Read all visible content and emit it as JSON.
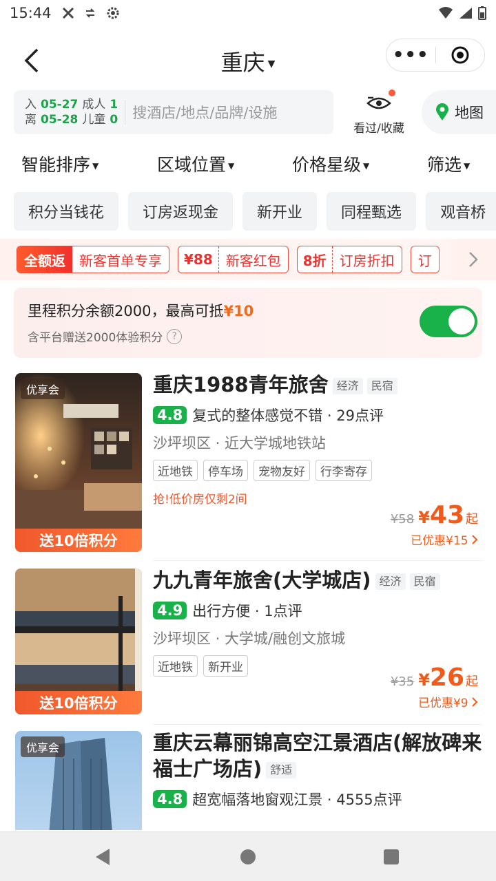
{
  "status_bar": {
    "time": "15:44"
  },
  "nav": {
    "title": "重庆",
    "more_label": "•••"
  },
  "search": {
    "checkin_label": "入",
    "checkin_date": "05-27",
    "checkout_label": "离",
    "checkout_date": "05-28",
    "adults_label": "成人",
    "adults": "1",
    "children_label": "儿童",
    "children": "0",
    "placeholder": "搜酒店/地点/品牌/设施"
  },
  "seen_fav_label": "看过/收藏",
  "map_label": "地图",
  "filters": [
    "智能排序",
    "区域位置",
    "价格星级",
    "筛选"
  ],
  "chips": [
    "积分当钱花",
    "订房返现金",
    "新开业",
    "同程甄选",
    "观音桥"
  ],
  "promo": {
    "full_rebate": "全额返",
    "new_first": "新客首单专享",
    "redpack_amount": "¥88",
    "redpack_label": "新客红包",
    "discount_amount": "8折",
    "discount_label": "订房折扣",
    "overflow_char": "订"
  },
  "points": {
    "line1_prefix": "里程积分余额2000，最高可抵",
    "line1_amount": "¥10",
    "line2": "含平台赠送2000体验积分",
    "help": "?",
    "toggle_on": true
  },
  "hotels": [
    {
      "badge_top": "优享会",
      "badge_bottom": "送10倍积分",
      "name": "重庆1988青年旅舍",
      "type_tags": [
        "经济",
        "民宿"
      ],
      "score": "4.8",
      "review": "复式的整体感觉不错 · 29点评",
      "location": "沙坪坝区 · 近大学城地铁站",
      "features": [
        "近地铁",
        "停车场",
        "宠物友好",
        "行李寄存"
      ],
      "urgent": "抢!低价房仅剩2间",
      "old_price": "¥58",
      "yen": "¥",
      "price": "43",
      "price_suffix": "起",
      "saved": "已优惠¥15"
    },
    {
      "badge_top": "",
      "badge_bottom": "送10倍积分",
      "name": "九九青年旅舍(大学城店)",
      "type_tags": [
        "经济",
        "民宿"
      ],
      "score": "4.9",
      "review": "出行方便 · 1点评",
      "location": "沙坪坝区 · 大学城/融创文旅城",
      "features": [
        "近地铁",
        "新开业"
      ],
      "urgent": "",
      "old_price": "¥35",
      "yen": "¥",
      "price": "26",
      "price_suffix": "起",
      "saved": "已优惠¥9"
    },
    {
      "badge_top": "优享会",
      "badge_bottom": "",
      "name": "重庆云幕丽锦高空江景酒店(解放碑来福士广场店)",
      "type_tags": [
        "舒适"
      ],
      "score": "4.8",
      "review": "超宽幅落地窗观江景 · 4555点评",
      "location": "",
      "features": [],
      "urgent": "",
      "old_price": "",
      "yen": "",
      "price": "",
      "price_suffix": "",
      "saved": ""
    }
  ]
}
